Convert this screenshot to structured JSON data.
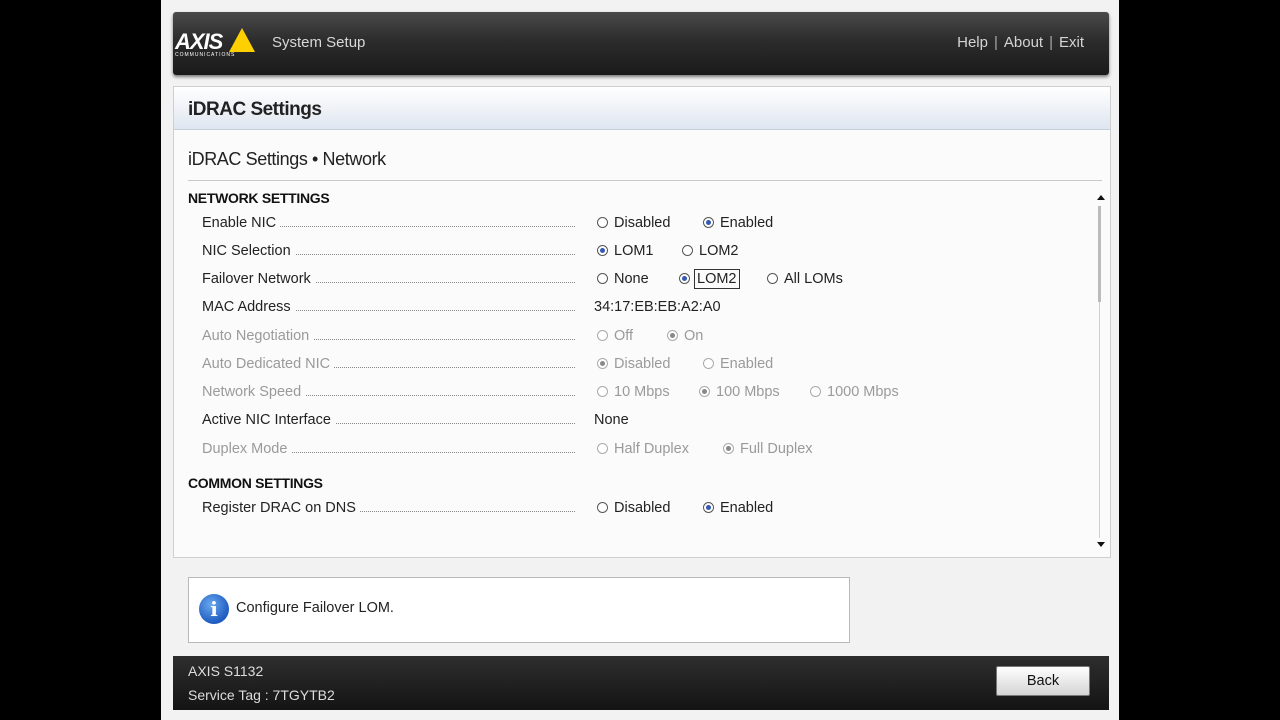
{
  "header": {
    "logo_text": "AXIS",
    "logo_sub": "COMMUNICATIONS",
    "app_title": "System Setup",
    "links": [
      "Help",
      "About",
      "Exit"
    ],
    "separator": "|"
  },
  "page": {
    "title": "iDRAC Settings",
    "subtitle": "iDRAC Settings • Network"
  },
  "sections": {
    "network": "NETWORK SETTINGS",
    "common": "COMMON SETTINGS"
  },
  "rows": {
    "enable_nic": {
      "label": "Enable NIC",
      "opts": [
        "Disabled",
        "Enabled"
      ],
      "selected": "Enabled"
    },
    "nic_selection": {
      "label": "NIC Selection",
      "opts": [
        "LOM1",
        "LOM2"
      ],
      "selected": "LOM1"
    },
    "failover_network": {
      "label": "Failover Network",
      "opts": [
        "None",
        "LOM2",
        "All LOMs"
      ],
      "selected": "LOM2"
    },
    "mac_address": {
      "label": "MAC Address",
      "value": "34:17:EB:EB:A2:A0"
    },
    "auto_negotiation": {
      "label": "Auto Negotiation",
      "opts": [
        "Off",
        "On"
      ],
      "selected": "On"
    },
    "auto_dedicated_nic": {
      "label": "Auto Dedicated NIC",
      "opts": [
        "Disabled",
        "Enabled"
      ],
      "selected": "Disabled"
    },
    "network_speed": {
      "label": "Network Speed",
      "opts": [
        "10 Mbps",
        "100 Mbps",
        "1000 Mbps"
      ],
      "selected": "100 Mbps"
    },
    "active_nic_interface": {
      "label": "Active NIC Interface",
      "value": "None"
    },
    "duplex_mode": {
      "label": "Duplex Mode",
      "opts": [
        "Half Duplex",
        "Full Duplex"
      ],
      "selected": "Full Duplex"
    },
    "register_drac_dns": {
      "label": "Register DRAC on DNS",
      "opts": [
        "Disabled",
        "Enabled"
      ],
      "selected": "Enabled"
    }
  },
  "message": {
    "icon_text": "i",
    "text": "Configure Failover LOM."
  },
  "footer": {
    "model": "AXIS S1132",
    "service_tag": "Service Tag : 7TGYTB2",
    "back_label": "Back"
  },
  "colors": {
    "header_bg": "#2c2c2c",
    "accent_radio": "#3558b0",
    "logo_yellow": "#ffd000"
  }
}
